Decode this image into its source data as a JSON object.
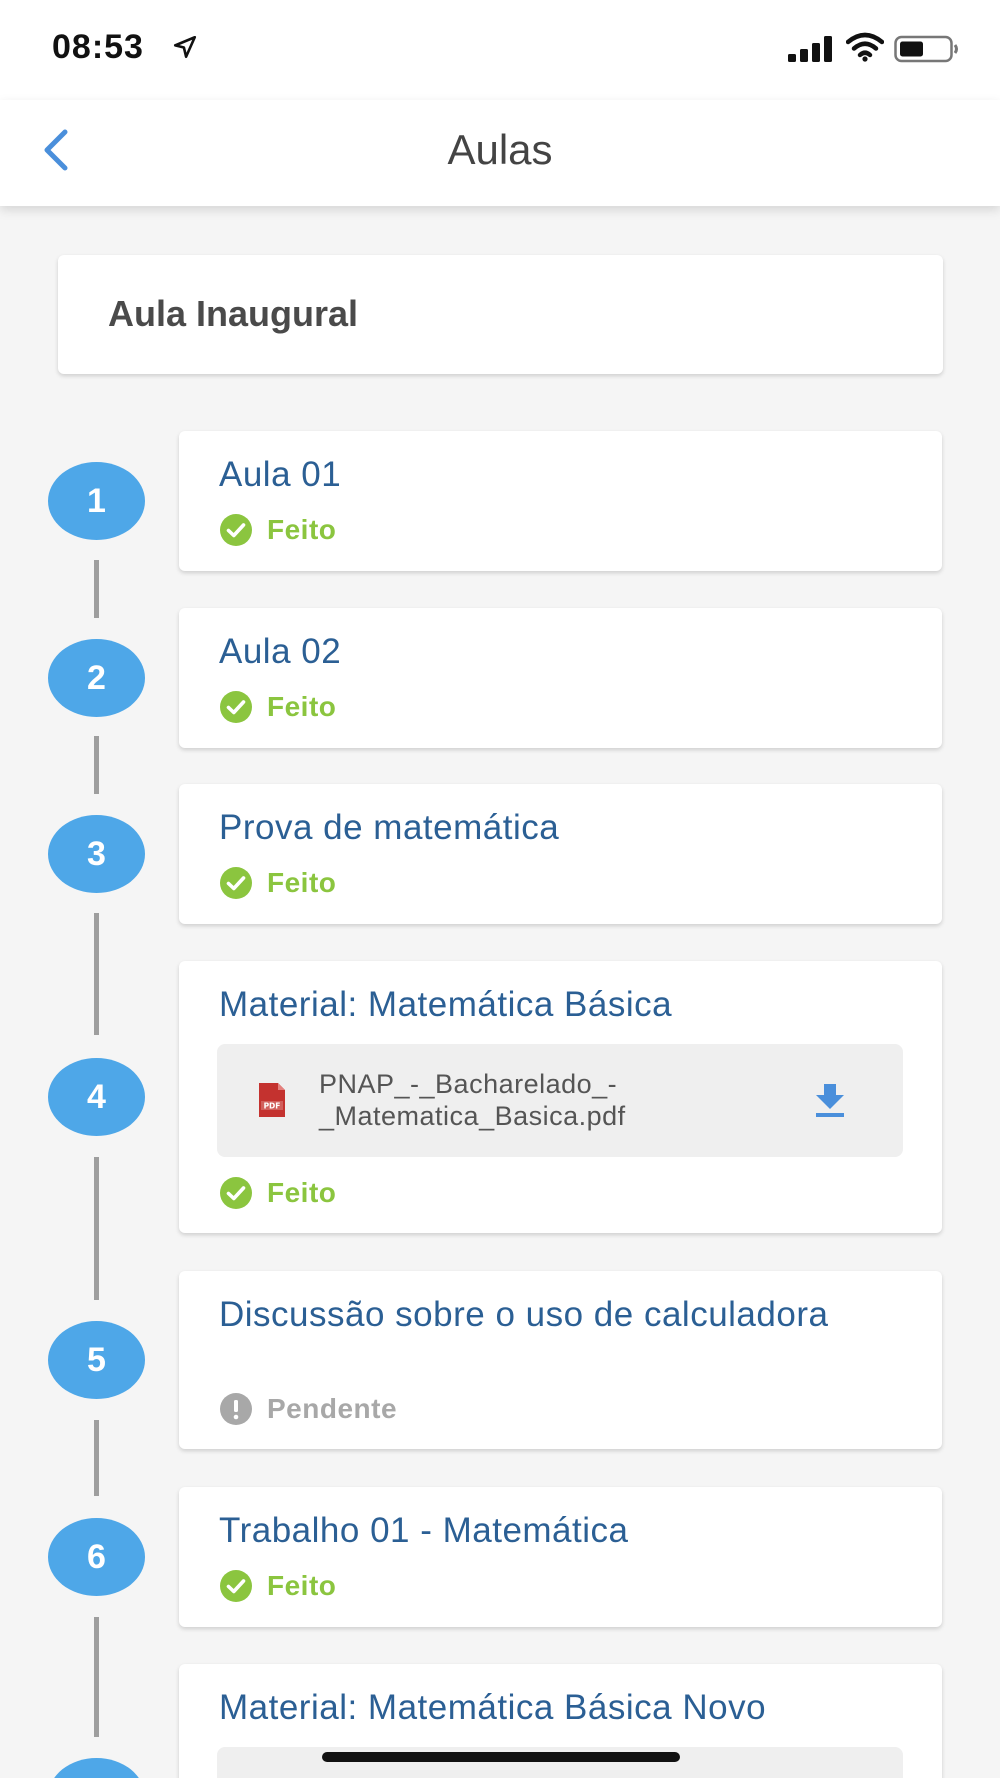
{
  "status_bar": {
    "time": "08:53"
  },
  "header": {
    "title": "Aulas"
  },
  "intro": {
    "title": "Aula Inaugural"
  },
  "colors": {
    "accent_blue": "#4ea7e8",
    "title_blue": "#2b5f94",
    "done_green": "#8bc53f",
    "pending_gray": "#a8a8a8"
  },
  "lessons": [
    {
      "number": "1",
      "title": "Aula 01",
      "status": "Feito",
      "state": "done"
    },
    {
      "number": "2",
      "title": "Aula 02",
      "status": "Feito",
      "state": "done"
    },
    {
      "number": "3",
      "title": "Prova de matemática",
      "status": "Feito",
      "state": "done"
    },
    {
      "number": "4",
      "title": "Material: Matemática Básica",
      "file_line1": "PNAP_-_Bacharelado_-",
      "file_line2": "_Matematica_Basica.pdf",
      "file_icon": "pdf-file-icon",
      "status": "Feito",
      "state": "done"
    },
    {
      "number": "5",
      "title": "Discussão sobre o uso de calculadora",
      "status": "Pendente",
      "state": "pending"
    },
    {
      "number": "6",
      "title": "Trabalho 01 - Matemática",
      "status": "Feito",
      "state": "done"
    },
    {
      "title": "Material: Matemática Básica Novo"
    }
  ]
}
